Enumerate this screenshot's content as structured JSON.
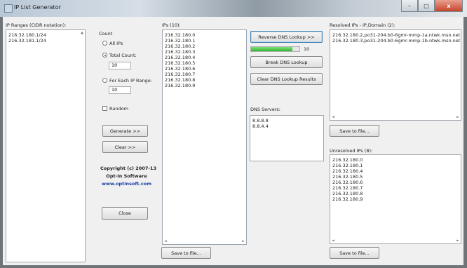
{
  "window": {
    "title": "IP List Generator",
    "min_label": "–",
    "max_label": "□",
    "close_label": "x"
  },
  "ip_ranges": {
    "label": "IP Ranges (CIDR notation):",
    "items": [
      "216.32.180.1/24",
      "216.32.181.1/24"
    ]
  },
  "count": {
    "label": "Count",
    "all_ips": "All IPs",
    "total_count": "Total Count:",
    "total_count_value": "10",
    "for_each": "For Each IP Range:",
    "for_each_value": "10",
    "random": "Random",
    "selected": "total_count",
    "random_checked": false
  },
  "actions": {
    "generate": "Generate >>",
    "clear": "Clear >>",
    "close": "Close"
  },
  "copyright": {
    "line1": "Copyright (c) 2007-13",
    "line2": "Opt-In Software",
    "url": "www.optinsoft.com"
  },
  "ips": {
    "label": "IPs (10):",
    "items": [
      "216.32.180.0",
      "216.32.180.1",
      "216.32.180.2",
      "216.32.180.3",
      "216.32.180.4",
      "216.32.180.5",
      "216.32.180.6",
      "216.32.180.7",
      "216.32.180.8",
      "216.32.180.9"
    ],
    "save": "Save to file..."
  },
  "dns": {
    "reverse": "Reverse DNS Lookup >>",
    "progress_value": "10",
    "progress_fraction": 0.85,
    "break": "Break DNS Lookup",
    "clear_results": "Clear DNS Lookup Results",
    "servers_label": "DNS Servers:",
    "servers": [
      "8.8.8.8",
      "8.8.4.4"
    ]
  },
  "resolved": {
    "label": "Resolved IPs - IP,Domain (2):",
    "items": [
      "216.32.180.2,po31-204.b0-6gmr-mmp-1a.ntwk.msn.net",
      "216.32.180.3,po31-204.b0-6gmr-mmp-1b.ntwk.msn.net"
    ],
    "save": "Save to file..."
  },
  "unresolved": {
    "label": "Unresolved IPs (8):",
    "items": [
      "216.32.180.0",
      "216.32.180.1",
      "216.32.180.4",
      "216.32.180.5",
      "216.32.180.6",
      "216.32.180.7",
      "216.32.180.8",
      "216.32.180.9"
    ],
    "save": "Save to file..."
  }
}
